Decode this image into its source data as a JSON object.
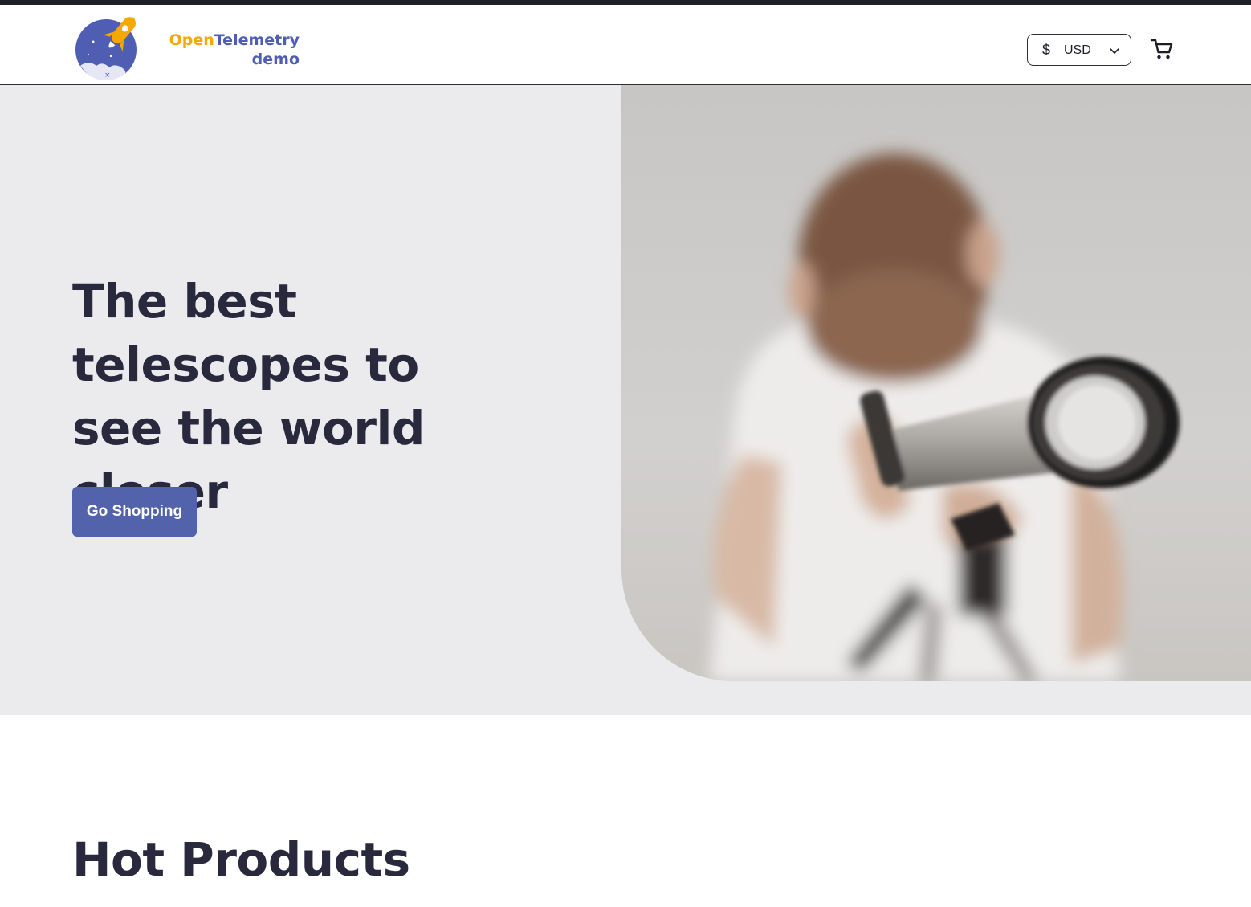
{
  "header": {
    "logo": {
      "word_open": "Open",
      "word_telemetry": "Telemetry",
      "word_demo": "demo"
    },
    "currency": {
      "symbol": "$",
      "code": "USD"
    },
    "icons": {
      "logo": "rocket-moon-logo",
      "currency_dropdown": "chevron-down-icon",
      "cart": "shopping-cart-icon"
    }
  },
  "hero": {
    "title": "The best telescopes to see the world closer",
    "cta_label": "Go Shopping",
    "image": "child-with-telescope-photo"
  },
  "sections": {
    "hot_products_title": "Hot Products"
  },
  "colors": {
    "accent": "#5262ab",
    "logo_orange": "#f5a800",
    "logo_blue": "#4f5eb3",
    "text_dark": "#29293e",
    "hero_bg": "#ebebed"
  }
}
